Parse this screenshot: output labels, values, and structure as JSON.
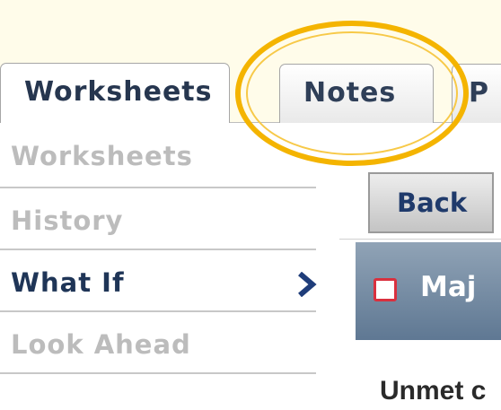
{
  "tabs": [
    {
      "label": "Worksheets",
      "active": true
    },
    {
      "label": "Notes",
      "active": false
    },
    {
      "label": "P",
      "active": false
    }
  ],
  "side_nav": {
    "items": [
      {
        "label": "Worksheets",
        "active": false
      },
      {
        "label": "History",
        "active": false
      },
      {
        "label": "What If",
        "active": true
      },
      {
        "label": "Look Ahead",
        "active": false
      }
    ]
  },
  "toolbar": {
    "back_label": "Back"
  },
  "panel": {
    "title": "Maj",
    "body_text": "Unmet c"
  },
  "colors": {
    "highlight_ring": "#f4b400",
    "active_nav_text": "#1f3557",
    "inactive_nav_text": "#bcbcbc",
    "panel_header": "#6f879f",
    "checkbox_border": "#d9303e"
  },
  "icons": {
    "active_item_indicator": "chevron-right-icon"
  }
}
